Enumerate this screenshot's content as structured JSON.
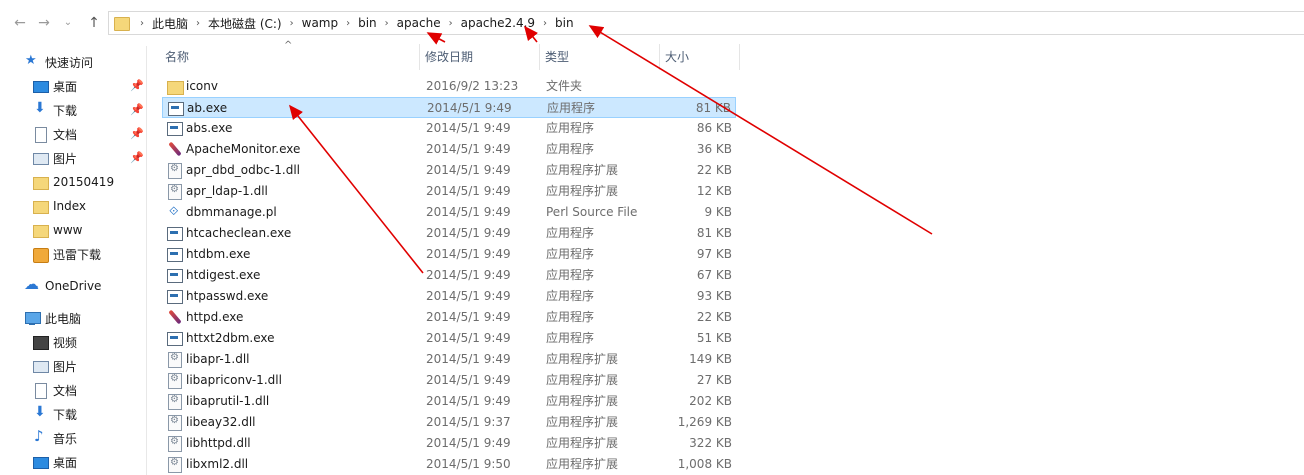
{
  "breadcrumb": [
    "此电脑",
    "本地磁盘 (C:)",
    "wamp",
    "bin",
    "apache",
    "apache2.4.9",
    "bin"
  ],
  "sidebar": {
    "quick_access": "快速访问",
    "quick_items": [
      "桌面",
      "下载",
      "文档",
      "图片",
      "20150419",
      "Index",
      "www",
      "迅雷下载"
    ],
    "onedrive": "OneDrive",
    "this_pc": "此电脑",
    "pc_items": [
      "视频",
      "图片",
      "文档",
      "下载",
      "音乐",
      "桌面"
    ]
  },
  "columns": [
    "名称",
    "修改日期",
    "类型",
    "大小"
  ],
  "files": [
    {
      "name": "iconv",
      "date": "2016/9/2 13:23",
      "type": "文件夹",
      "size": "",
      "icon": "folder-icon"
    },
    {
      "name": "ab.exe",
      "date": "2014/5/1 9:49",
      "type": "应用程序",
      "size": "81 KB",
      "icon": "exe-icon"
    },
    {
      "name": "abs.exe",
      "date": "2014/5/1 9:49",
      "type": "应用程序",
      "size": "86 KB",
      "icon": "exe-icon"
    },
    {
      "name": "ApacheMonitor.exe",
      "date": "2014/5/1 9:49",
      "type": "应用程序",
      "size": "36 KB",
      "icon": "feather-icon"
    },
    {
      "name": "apr_dbd_odbc-1.dll",
      "date": "2014/5/1 9:49",
      "type": "应用程序扩展",
      "size": "22 KB",
      "icon": "dll-icon"
    },
    {
      "name": "apr_ldap-1.dll",
      "date": "2014/5/1 9:49",
      "type": "应用程序扩展",
      "size": "12 KB",
      "icon": "dll-icon"
    },
    {
      "name": "dbmmanage.pl",
      "date": "2014/5/1 9:49",
      "type": "Perl Source File",
      "size": "9 KB",
      "icon": "perl-icon"
    },
    {
      "name": "htcacheclean.exe",
      "date": "2014/5/1 9:49",
      "type": "应用程序",
      "size": "81 KB",
      "icon": "exe-icon"
    },
    {
      "name": "htdbm.exe",
      "date": "2014/5/1 9:49",
      "type": "应用程序",
      "size": "97 KB",
      "icon": "exe-icon"
    },
    {
      "name": "htdigest.exe",
      "date": "2014/5/1 9:49",
      "type": "应用程序",
      "size": "67 KB",
      "icon": "exe-icon"
    },
    {
      "name": "htpasswd.exe",
      "date": "2014/5/1 9:49",
      "type": "应用程序",
      "size": "93 KB",
      "icon": "exe-icon"
    },
    {
      "name": "httpd.exe",
      "date": "2014/5/1 9:49",
      "type": "应用程序",
      "size": "22 KB",
      "icon": "feather-icon"
    },
    {
      "name": "httxt2dbm.exe",
      "date": "2014/5/1 9:49",
      "type": "应用程序",
      "size": "51 KB",
      "icon": "exe-icon"
    },
    {
      "name": "libapr-1.dll",
      "date": "2014/5/1 9:49",
      "type": "应用程序扩展",
      "size": "149 KB",
      "icon": "dll-icon"
    },
    {
      "name": "libapriconv-1.dll",
      "date": "2014/5/1 9:49",
      "type": "应用程序扩展",
      "size": "27 KB",
      "icon": "dll-icon"
    },
    {
      "name": "libaprutil-1.dll",
      "date": "2014/5/1 9:49",
      "type": "应用程序扩展",
      "size": "202 KB",
      "icon": "dll-icon"
    },
    {
      "name": "libeay32.dll",
      "date": "2014/5/1 9:37",
      "type": "应用程序扩展",
      "size": "1,269 KB",
      "icon": "dll-icon"
    },
    {
      "name": "libhttpd.dll",
      "date": "2014/5/1 9:49",
      "type": "应用程序扩展",
      "size": "322 KB",
      "icon": "dll-icon"
    },
    {
      "name": "libxml2.dll",
      "date": "2014/5/1 9:50",
      "type": "应用程序扩展",
      "size": "1,008 KB",
      "icon": "dll-icon"
    }
  ],
  "selected_row": 1,
  "colors": {
    "selection_bg": "#cce8ff",
    "selection_border": "#99d1ff",
    "annotation": "#e00000"
  }
}
